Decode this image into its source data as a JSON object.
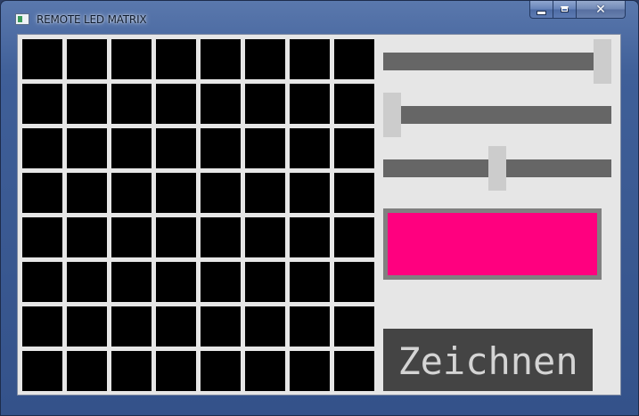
{
  "window": {
    "title": "REMOTE LED MATRIX",
    "icon": "app-window-icon"
  },
  "caption_buttons": {
    "minimize_icon": "minimize-icon",
    "maximize_icon": "maximize-icon",
    "close_icon": "close-icon",
    "close_glyph": "✕"
  },
  "matrix": {
    "rows": 8,
    "columns": 8,
    "led_color": "#000000",
    "leds": [
      [
        0,
        0,
        0,
        0,
        0,
        0,
        0,
        0
      ],
      [
        0,
        0,
        0,
        0,
        0,
        0,
        0,
        0
      ],
      [
        0,
        0,
        0,
        0,
        0,
        0,
        0,
        0
      ],
      [
        0,
        0,
        0,
        0,
        0,
        0,
        0,
        0
      ],
      [
        0,
        0,
        0,
        0,
        0,
        0,
        0,
        0
      ],
      [
        0,
        0,
        0,
        0,
        0,
        0,
        0,
        0
      ],
      [
        0,
        0,
        0,
        0,
        0,
        0,
        0,
        0
      ],
      [
        0,
        0,
        0,
        0,
        0,
        0,
        0,
        0
      ]
    ]
  },
  "sliders": [
    {
      "name": "slider-red",
      "value": 1.0
    },
    {
      "name": "slider-green",
      "value": 0.0
    },
    {
      "name": "slider-blue",
      "value": 0.5
    }
  ],
  "color_preview": {
    "color": "#ff007f"
  },
  "draw_button": {
    "label": "Zeichnen"
  },
  "colors": {
    "slider_track": "#666666",
    "slider_thumb": "#cccccc",
    "client_background": "#e6e6e6",
    "button_background": "#444444",
    "button_text": "#d4d4d4"
  }
}
